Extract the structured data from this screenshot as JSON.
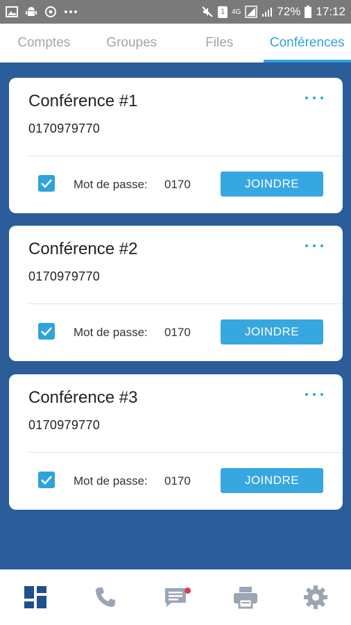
{
  "status_bar": {
    "battery": "72%",
    "time": "17:12",
    "network": "4G",
    "sim": "1"
  },
  "tabs": [
    {
      "label": "Comptes",
      "active": false
    },
    {
      "label": "Groupes",
      "active": false
    },
    {
      "label": "Files",
      "active": false
    },
    {
      "label": "Conférences",
      "active": true
    }
  ],
  "conferences": [
    {
      "title": "Conférence #1",
      "number": "0170979770",
      "password_label": "Mot de passe:",
      "password": "0170",
      "checked": true,
      "join_label": "JOINDRE"
    },
    {
      "title": "Conférence #2",
      "number": "0170979770",
      "password_label": "Mot de passe:",
      "password": "0170",
      "checked": true,
      "join_label": "JOINDRE"
    },
    {
      "title": "Conférence #3",
      "number": "0170979770",
      "password_label": "Mot de passe:",
      "password": "0170",
      "checked": true,
      "join_label": "JOINDRE"
    }
  ],
  "bottom_nav": [
    {
      "icon": "dashboard-icon",
      "active": true
    },
    {
      "icon": "phone-icon",
      "active": false
    },
    {
      "icon": "message-icon",
      "active": false,
      "badge": true
    },
    {
      "icon": "printer-icon",
      "active": false
    },
    {
      "icon": "settings-icon",
      "active": false
    }
  ],
  "colors": {
    "accent": "#2fa3da",
    "background": "#2a5d99",
    "nav_active": "#1f4f8c",
    "nav_inactive": "#9aa6b6",
    "badge": "#e8384f"
  }
}
